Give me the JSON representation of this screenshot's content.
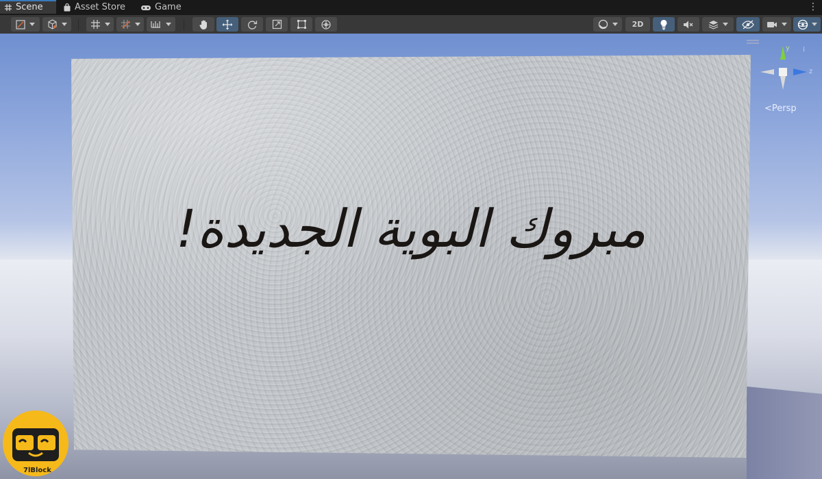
{
  "tabs": [
    {
      "label": "Scene",
      "icon": "grid-icon",
      "active": true
    },
    {
      "label": "Asset Store",
      "icon": "bag-icon",
      "active": false
    },
    {
      "label": "Game",
      "icon": "gamepad-icon",
      "active": false
    }
  ],
  "tab_menu_icon": "kebab-menu-icon",
  "toolbar": {
    "left_tools": [
      "draw-mode-icon",
      "render-cube-icon",
      "grid-snap-icon",
      "increment-snap-icon",
      "ruler-icon"
    ],
    "transform_tools": [
      "hand-tool-icon",
      "move-tool-icon",
      "rotate-tool-icon",
      "scale-tool-icon",
      "rect-tool-icon",
      "transform-tool-icon"
    ],
    "active_tool": "move-tool-icon",
    "shading_icon": "shading-sphere-icon",
    "mode_2d_label": "2D",
    "lighting_icon": "lightbulb-icon",
    "audio_icon": "audio-mute-icon",
    "effects_icon": "effects-stack-icon",
    "visibility_icon": "hidden-eye-icon",
    "camera_icon": "camera-icon",
    "gizmos_icon": "gizmo-globe-icon"
  },
  "scene": {
    "wall_text": "مبروك البوية الجديدة!",
    "gizmo_axes": [
      "y",
      "z"
    ],
    "projection_label": "Persp",
    "accent_color": "#3a79bb",
    "sky_color": "#7b97d5"
  },
  "logo": {
    "brand": "7lBlock",
    "icon": "glasses-face-icon",
    "color": "#f6b91a"
  }
}
